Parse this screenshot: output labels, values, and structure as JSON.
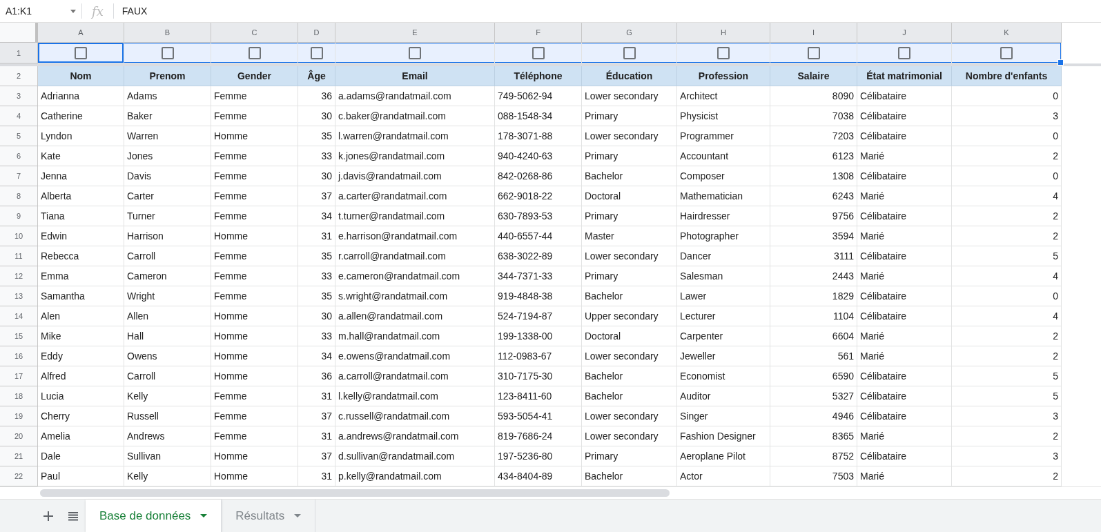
{
  "formula_bar": {
    "name_box": "A1:K1",
    "function_label": "fx",
    "value": "FAUX"
  },
  "sheet": {
    "columns": [
      {
        "letter": "A",
        "header": "Nom",
        "kind": "text"
      },
      {
        "letter": "B",
        "header": "Prenom",
        "kind": "text"
      },
      {
        "letter": "C",
        "header": "Gender",
        "kind": "text"
      },
      {
        "letter": "D",
        "header": "Âge",
        "kind": "number"
      },
      {
        "letter": "E",
        "header": "Email",
        "kind": "text"
      },
      {
        "letter": "F",
        "header": "Téléphone",
        "kind": "text"
      },
      {
        "letter": "G",
        "header": "Éducation",
        "kind": "text"
      },
      {
        "letter": "H",
        "header": "Profession",
        "kind": "text"
      },
      {
        "letter": "I",
        "header": "Salaire",
        "kind": "number"
      },
      {
        "letter": "J",
        "header": "État matrimonial",
        "kind": "text"
      },
      {
        "letter": "K",
        "header": "Nombre d'enfants",
        "kind": "number"
      }
    ],
    "checkbox_row": {
      "number": "1",
      "selected": true,
      "checkboxes": [
        {
          "checked": false
        },
        {
          "checked": false
        },
        {
          "checked": false
        },
        {
          "checked": false
        },
        {
          "checked": false
        },
        {
          "checked": false
        },
        {
          "checked": false
        },
        {
          "checked": false
        },
        {
          "checked": false
        },
        {
          "checked": false
        },
        {
          "checked": false
        }
      ]
    },
    "header_row_number": "2",
    "rows": [
      {
        "number": "3",
        "cells": [
          "Adrianna",
          "Adams",
          "Femme",
          "36",
          "a.adams@randatmail.com",
          "749-5062-94",
          "Lower secondary",
          "Architect",
          "8090",
          "Célibataire",
          "0"
        ]
      },
      {
        "number": "4",
        "cells": [
          "Catherine",
          "Baker",
          "Femme",
          "30",
          "c.baker@randatmail.com",
          "088-1548-34",
          "Primary",
          "Physicist",
          "7038",
          "Célibataire",
          "3"
        ]
      },
      {
        "number": "5",
        "cells": [
          "Lyndon",
          "Warren",
          "Homme",
          "35",
          "l.warren@randatmail.com",
          "178-3071-88",
          "Lower secondary",
          "Programmer",
          "7203",
          "Célibataire",
          "0"
        ]
      },
      {
        "number": "6",
        "cells": [
          "Kate",
          "Jones",
          "Femme",
          "33",
          "k.jones@randatmail.com",
          "940-4240-63",
          "Primary",
          "Accountant",
          "6123",
          "Marié",
          "2"
        ]
      },
      {
        "number": "7",
        "cells": [
          "Jenna",
          "Davis",
          "Femme",
          "30",
          "j.davis@randatmail.com",
          "842-0268-86",
          "Bachelor",
          "Composer",
          "1308",
          "Célibataire",
          "0"
        ]
      },
      {
        "number": "8",
        "cells": [
          "Alberta",
          "Carter",
          "Femme",
          "37",
          "a.carter@randatmail.com",
          "662-9018-22",
          "Doctoral",
          "Mathematician",
          "6243",
          "Marié",
          "4"
        ]
      },
      {
        "number": "9",
        "cells": [
          "Tiana",
          "Turner",
          "Femme",
          "34",
          "t.turner@randatmail.com",
          "630-7893-53",
          "Primary",
          "Hairdresser",
          "9756",
          "Célibataire",
          "2"
        ]
      },
      {
        "number": "10",
        "cells": [
          "Edwin",
          "Harrison",
          "Homme",
          "31",
          "e.harrison@randatmail.com",
          "440-6557-44",
          "Master",
          "Photographer",
          "3594",
          "Marié",
          "2"
        ]
      },
      {
        "number": "11",
        "cells": [
          "Rebecca",
          "Carroll",
          "Femme",
          "35",
          "r.carroll@randatmail.com",
          "638-3022-89",
          "Lower secondary",
          "Dancer",
          "3111",
          "Célibataire",
          "5"
        ]
      },
      {
        "number": "12",
        "cells": [
          "Emma",
          "Cameron",
          "Femme",
          "33",
          "e.cameron@randatmail.com",
          "344-7371-33",
          "Primary",
          "Salesman",
          "2443",
          "Marié",
          "4"
        ]
      },
      {
        "number": "13",
        "cells": [
          "Samantha",
          "Wright",
          "Femme",
          "35",
          "s.wright@randatmail.com",
          "919-4848-38",
          "Bachelor",
          "Lawer",
          "1829",
          "Célibataire",
          "0"
        ]
      },
      {
        "number": "14",
        "cells": [
          "Alen",
          "Allen",
          "Homme",
          "30",
          "a.allen@randatmail.com",
          "524-7194-87",
          "Upper secondary",
          "Lecturer",
          "1104",
          "Célibataire",
          "4"
        ]
      },
      {
        "number": "15",
        "cells": [
          "Mike",
          "Hall",
          "Homme",
          "33",
          "m.hall@randatmail.com",
          "199-1338-00",
          "Doctoral",
          "Carpenter",
          "6604",
          "Marié",
          "2"
        ]
      },
      {
        "number": "16",
        "cells": [
          "Eddy",
          "Owens",
          "Homme",
          "34",
          "e.owens@randatmail.com",
          "112-0983-67",
          "Lower secondary",
          "Jeweller",
          "561",
          "Marié",
          "2"
        ]
      },
      {
        "number": "17",
        "cells": [
          "Alfred",
          "Carroll",
          "Homme",
          "36",
          "a.carroll@randatmail.com",
          "310-7175-30",
          "Bachelor",
          "Economist",
          "6590",
          "Célibataire",
          "5"
        ]
      },
      {
        "number": "18",
        "cells": [
          "Lucia",
          "Kelly",
          "Femme",
          "31",
          "l.kelly@randatmail.com",
          "123-8411-60",
          "Bachelor",
          "Auditor",
          "5327",
          "Célibataire",
          "5"
        ]
      },
      {
        "number": "19",
        "cells": [
          "Cherry",
          "Russell",
          "Femme",
          "37",
          "c.russell@randatmail.com",
          "593-5054-41",
          "Lower secondary",
          "Singer",
          "4946",
          "Célibataire",
          "3"
        ]
      },
      {
        "number": "20",
        "cells": [
          "Amelia",
          "Andrews",
          "Femme",
          "31",
          "a.andrews@randatmail.com",
          "819-7686-24",
          "Lower secondary",
          "Fashion Designer",
          "8365",
          "Marié",
          "2"
        ]
      },
      {
        "number": "21",
        "cells": [
          "Dale",
          "Sullivan",
          "Homme",
          "37",
          "d.sullivan@randatmail.com",
          "197-5236-80",
          "Primary",
          "Aeroplane Pilot",
          "8752",
          "Célibataire",
          "3"
        ]
      },
      {
        "number": "22",
        "cells": [
          "Paul",
          "Kelly",
          "Homme",
          "31",
          "p.kelly@randatmail.com",
          "434-8404-89",
          "Bachelor",
          "Actor",
          "7503",
          "Marié",
          "2"
        ]
      }
    ]
  },
  "sheet_tabs": [
    {
      "label": "Base de données",
      "selected": true
    },
    {
      "label": "Résultats",
      "selected": false
    }
  ]
}
